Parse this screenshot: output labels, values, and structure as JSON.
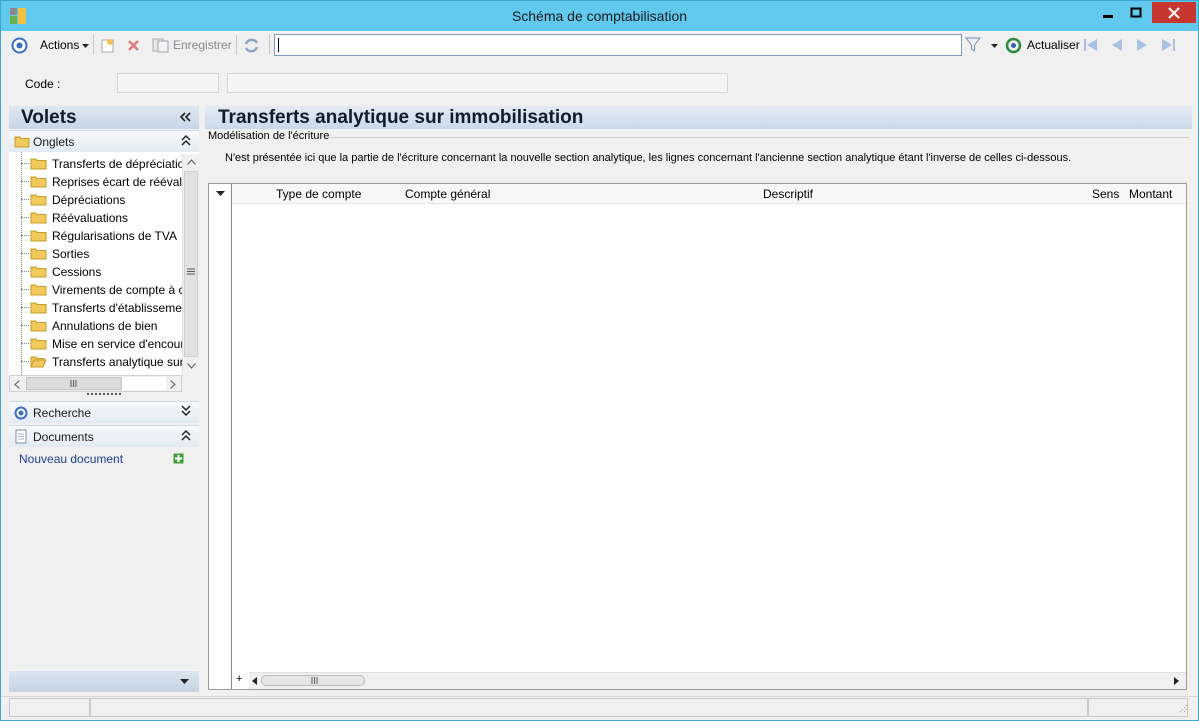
{
  "window": {
    "title": "Schéma de comptabilisation"
  },
  "toolbar": {
    "actions_label": "Actions",
    "save_label": "Enregistrer",
    "search_value": "",
    "refresh_label": "Actualiser"
  },
  "code": {
    "label": "Code :",
    "value": "",
    "description": ""
  },
  "sidebar": {
    "title": "Volets",
    "onglets_label": "Onglets",
    "items": [
      {
        "label": "Transferts de dépréciation"
      },
      {
        "label": "Reprises écart de réévaluation"
      },
      {
        "label": "Dépréciations"
      },
      {
        "label": "Réévaluations"
      },
      {
        "label": "Régularisations de TVA"
      },
      {
        "label": "Sorties"
      },
      {
        "label": "Cessions"
      },
      {
        "label": "Virements de compte à compte"
      },
      {
        "label": "Transferts d'établissement"
      },
      {
        "label": "Annulations de bien"
      },
      {
        "label": "Mise en service d'encours"
      },
      {
        "label": "Transferts analytique sur immobilisation",
        "selected": true
      }
    ],
    "recherche_label": "Recherche",
    "documents_label": "Documents",
    "new_document_label": "Nouveau document"
  },
  "main": {
    "title": "Transferts analytique sur immobilisation",
    "group_label": "Modélisation de l'écriture",
    "info_text": "N'est présentée ici que la partie de l'écriture concernant la nouvelle section analytique, les lignes concernant l'ancienne section analytique étant l'inverse de celles ci-dessous.",
    "columns": [
      "Type de compte",
      "Compte général",
      "Descriptif",
      "Sens",
      "Montant"
    ],
    "rows": []
  },
  "icons": {
    "back": "circle-back-icon",
    "new": "new-document-icon",
    "delete": "delete-icon",
    "save": "save-icon",
    "sync": "sync-icon",
    "filter": "funnel-icon",
    "refresh": "refresh-icon",
    "first": "first-record-icon",
    "prev": "previous-record-icon",
    "next": "next-record-icon",
    "last": "last-record-icon"
  },
  "colors": {
    "title_bar": "#62c9ee",
    "close_button": "#c7372f",
    "link": "#1f3f8f"
  }
}
